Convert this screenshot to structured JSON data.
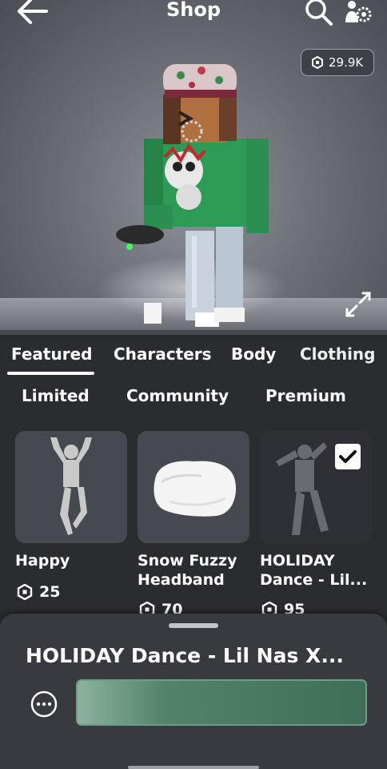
{
  "header": {
    "title": "Shop"
  },
  "balance": {
    "amount": "29.9K"
  },
  "tabs_primary": [
    {
      "label": "Featured"
    },
    {
      "label": "Characters"
    },
    {
      "label": "Body"
    },
    {
      "label": "Clothing"
    }
  ],
  "tabs_secondary": [
    {
      "label": "Limited"
    },
    {
      "label": "Community"
    },
    {
      "label": "Premium"
    }
  ],
  "items": [
    {
      "name": "Happy",
      "price": "25",
      "selected": false
    },
    {
      "name": "Snow Fuzzy\nHeadband",
      "price": "70",
      "selected": false
    },
    {
      "name": "HOLIDAY\nDance - Lil...",
      "price": "95",
      "selected": true
    }
  ],
  "detail_sheet": {
    "title": "HOLIDAY Dance - Lil Nas X..."
  },
  "colors": {
    "background": "#2b2c30",
    "card": "#474950",
    "sheet": "#393a40",
    "buy_button": "#3f6e58"
  }
}
